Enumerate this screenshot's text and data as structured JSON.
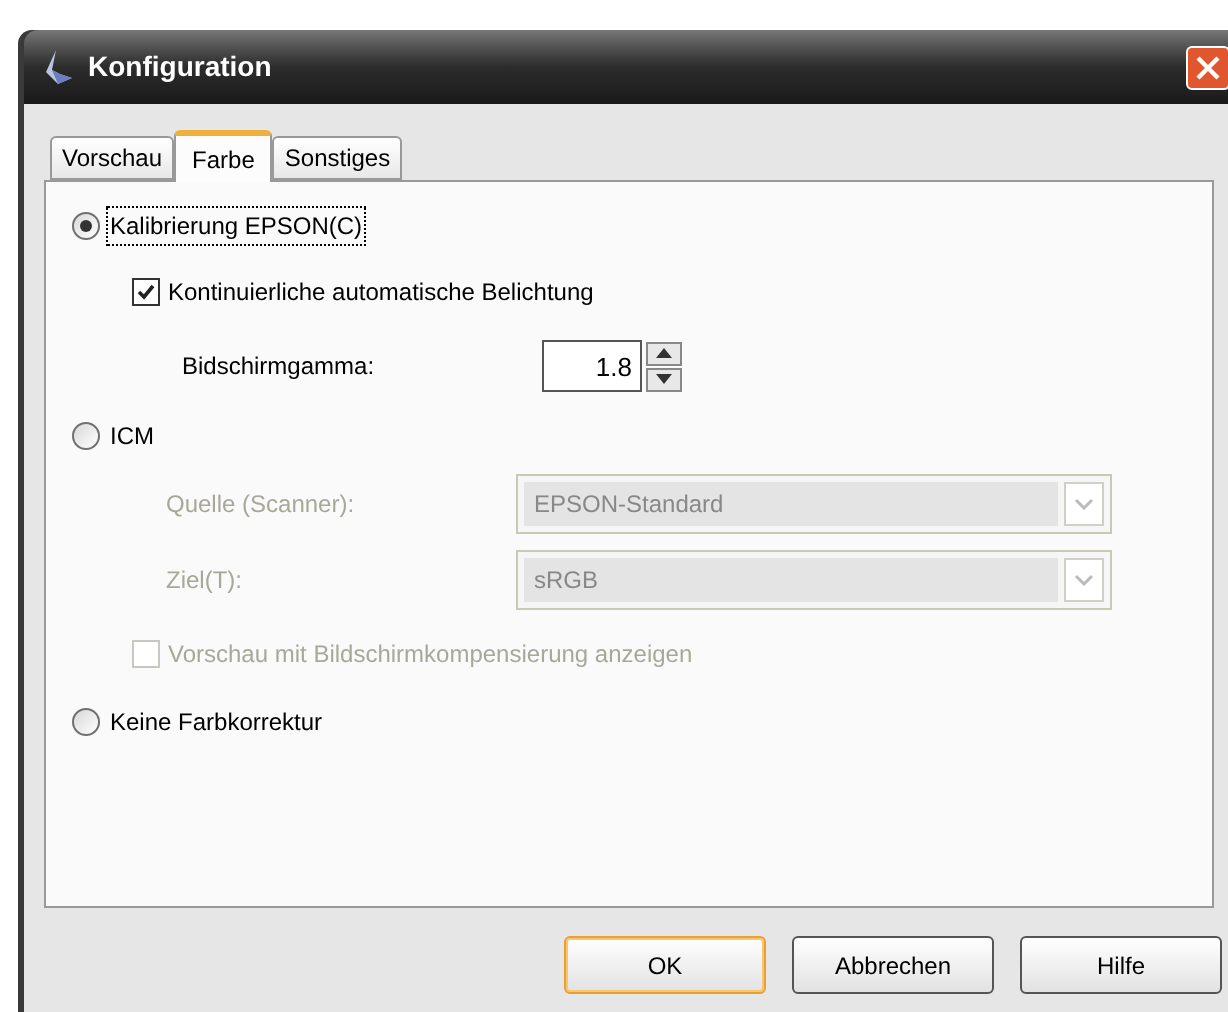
{
  "window": {
    "title": "Konfiguration"
  },
  "tabs": [
    {
      "label": "Vorschau",
      "selected": false
    },
    {
      "label": "Farbe",
      "selected": true
    },
    {
      "label": "Sonstiges",
      "selected": false
    }
  ],
  "options": [
    {
      "kind": "radio",
      "label": "Kalibrierung EPSON(C)",
      "selected": true,
      "disabled": false,
      "focused": true
    },
    {
      "kind": "checkbox",
      "label": "Kontinuierliche automatische Belichtung",
      "checked": true,
      "disabled": false
    },
    {
      "kind": "spinner",
      "label": "Bidschirmgamma:",
      "value": "1.8",
      "disabled": false
    },
    {
      "kind": "radio",
      "label": "ICM",
      "selected": false,
      "disabled": false,
      "focused": false
    },
    {
      "kind": "combo",
      "label": "Quelle (Scanner):",
      "value": "EPSON-Standard",
      "disabled": true
    },
    {
      "kind": "combo",
      "label": "Ziel(T):",
      "value": "sRGB",
      "disabled": true
    },
    {
      "kind": "checkbox",
      "label": "Vorschau mit Bildschirmkompensierung anzeigen",
      "checked": false,
      "disabled": true
    },
    {
      "kind": "radio",
      "label": "Keine Farbkorrektur",
      "selected": false,
      "disabled": false,
      "focused": false
    }
  ],
  "buttons": [
    {
      "label": "OK",
      "default": true
    },
    {
      "label": "Abbrechen",
      "default": false
    },
    {
      "label": "Hilfe",
      "default": false
    }
  ]
}
